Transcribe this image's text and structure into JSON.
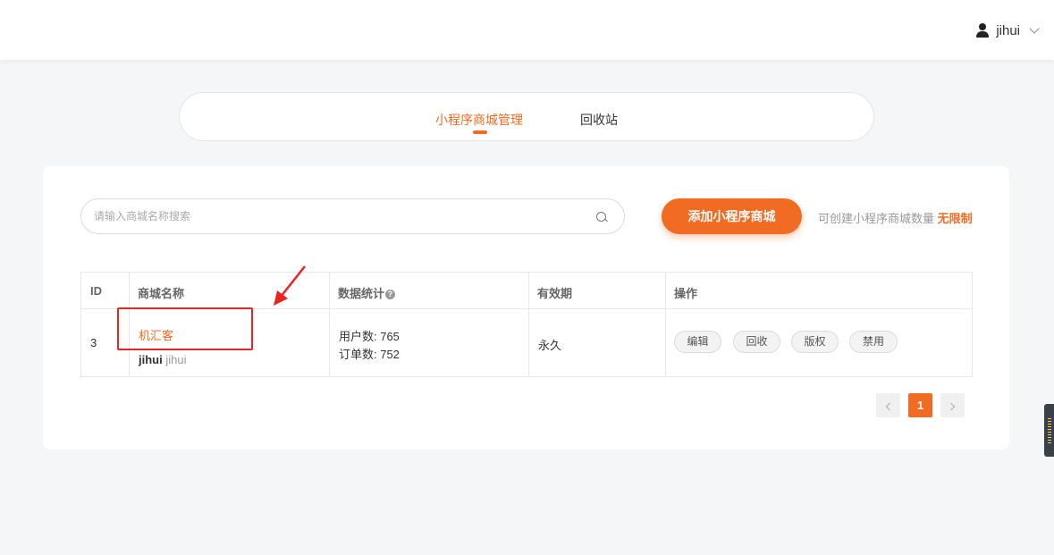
{
  "header": {
    "username": "jihui"
  },
  "tabs": [
    {
      "label": "小程序商城管理",
      "active": true
    },
    {
      "label": "回收站",
      "active": false
    }
  ],
  "toolbar": {
    "search_placeholder": "请输入商城名称搜索",
    "add_button": "添加小程序商城",
    "quota_text": "可创建小程序商城数量",
    "quota_value": "无限制"
  },
  "table": {
    "headers": [
      "ID",
      "商城名称",
      "数据统计",
      "有效期",
      "操作"
    ],
    "rows": [
      {
        "id": "3",
        "shop_name": "机汇客",
        "owner_bold": "jihui",
        "owner_grey": "jihui",
        "users": "用户数: 765",
        "orders": "订单数: 752",
        "validity": "永久",
        "actions": [
          "编辑",
          "回收",
          "版权",
          "禁用"
        ]
      }
    ]
  },
  "pagination": {
    "current": "1"
  },
  "colors": {
    "accent": "#f26b22",
    "annotation": "#e8251f"
  }
}
